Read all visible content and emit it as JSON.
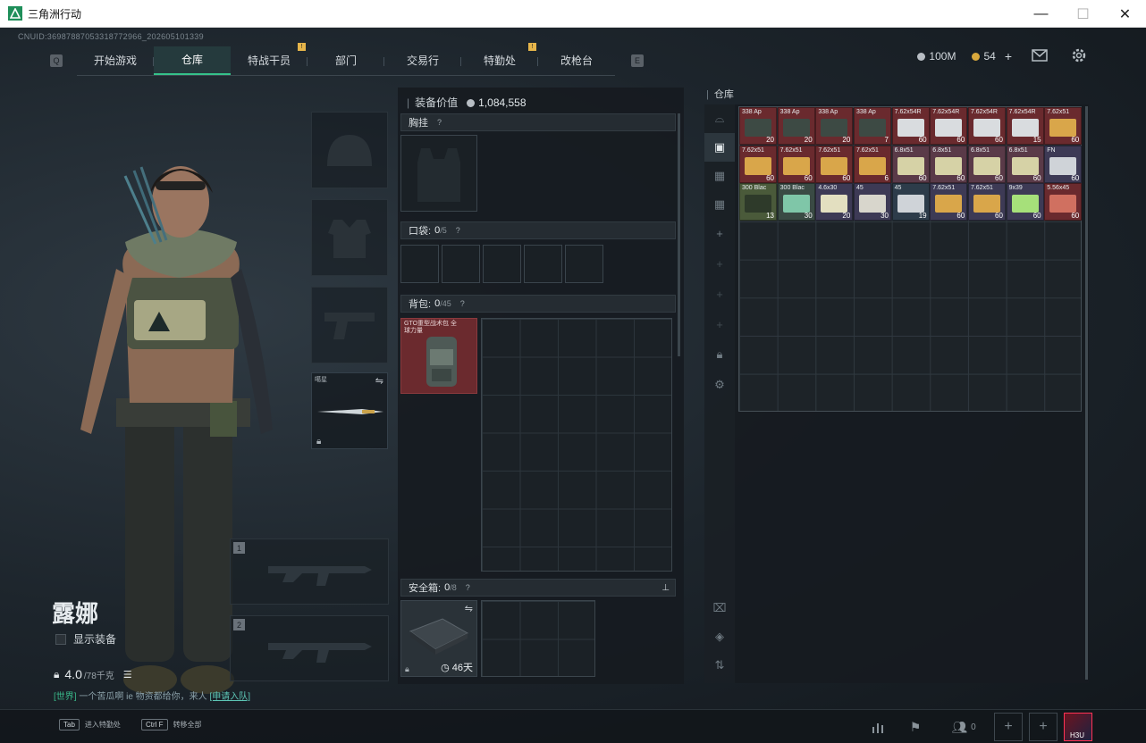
{
  "window": {
    "title": "三角洲行动",
    "controls": [
      "—",
      "☐",
      "✕"
    ]
  },
  "uid": "CNUID:369878870533187729​66_202605101339",
  "nav": {
    "left_key": "Q",
    "right_key": "E",
    "items": [
      {
        "label": "开始游戏",
        "active": false,
        "badge": false
      },
      {
        "label": "仓库",
        "active": true,
        "badge": false
      },
      {
        "label": "特战干员",
        "active": false,
        "badge": true
      },
      {
        "label": "部门",
        "active": false,
        "badge": false
      },
      {
        "label": "交易行",
        "active": false,
        "badge": false
      },
      {
        "label": "特勤处",
        "active": false,
        "badge": true
      },
      {
        "label": "改枪台",
        "active": false,
        "badge": false
      }
    ],
    "badge_text": "!"
  },
  "currency": {
    "silver": "100M",
    "gold": "54",
    "add": "+"
  },
  "character": {
    "name": "露娜",
    "show_equip_label": "显示装备",
    "weight": "4.0",
    "weight_cap": "/78千克",
    "melee_label": "噶星",
    "weapon_slot_1": "1",
    "weapon_slot_2": "2"
  },
  "chat": {
    "channel": "[世界]",
    "text": "一个苦瓜啊 ie  物资都给你，来人",
    "link": "[申请入队]"
  },
  "equipment": {
    "value_label": "装备价值",
    "value": "1,084,558",
    "chest_rig": {
      "label": "胸挂",
      "q": "?"
    },
    "pockets": {
      "label": "口袋:",
      "count": "0",
      "cap": "/5",
      "q": "?"
    },
    "backpack": {
      "label": "背包:",
      "count": "0",
      "cap": "/45",
      "q": "?",
      "item_name": "GTO重型战术包 全球力量"
    },
    "safe_box": {
      "label": "安全箱:",
      "count": "0",
      "cap": "/8",
      "q": "?",
      "time": "46天"
    }
  },
  "stash": {
    "label": "仓库",
    "items": [
      {
        "name": "338 Ap",
        "qty": "20",
        "color": "#6a2a2e",
        "box": "#3d4a44"
      },
      {
        "name": "338 Ap",
        "qty": "20",
        "color": "#6a2a2e",
        "box": "#3d4a44"
      },
      {
        "name": "338 Ap",
        "qty": "20",
        "color": "#6a2a2e",
        "box": "#3d4a44"
      },
      {
        "name": "338 Ap",
        "qty": "7",
        "color": "#6a2a2e",
        "box": "#3d4a44"
      },
      {
        "name": "7.62x54R",
        "qty": "60",
        "color": "#6a2a2e",
        "box": "#d9dcdf"
      },
      {
        "name": "7.62x54R",
        "qty": "60",
        "color": "#6a2a2e",
        "box": "#d9dcdf"
      },
      {
        "name": "7.62x54R",
        "qty": "60",
        "color": "#6a2a2e",
        "box": "#d9dcdf"
      },
      {
        "name": "7.62x54R",
        "qty": "15",
        "color": "#6a2a2e",
        "box": "#d9dcdf"
      },
      {
        "name": "7.62x51",
        "qty": "60",
        "color": "#6a2a2e",
        "box": "#d9a64a"
      },
      {
        "name": "7.62x51",
        "qty": "60",
        "color": "#6a2a2e",
        "box": "#d9a64a"
      },
      {
        "name": "7.62x51",
        "qty": "60",
        "color": "#6a2a2e",
        "box": "#d9a64a"
      },
      {
        "name": "7.62x51",
        "qty": "60",
        "color": "#6a2a2e",
        "box": "#d9a64a"
      },
      {
        "name": "7.62x51",
        "qty": "6",
        "color": "#6a2a2e",
        "box": "#d9a64a"
      },
      {
        "name": "6.8x51",
        "qty": "60",
        "color": "#5a3a48",
        "box": "#d6d2a6"
      },
      {
        "name": "6.8x51",
        "qty": "60",
        "color": "#5a3a48",
        "box": "#d6d2a6"
      },
      {
        "name": "6.8x51",
        "qty": "60",
        "color": "#5a3a48",
        "box": "#d6d2a6"
      },
      {
        "name": "6.8x51",
        "qty": "60",
        "color": "#5a3a48",
        "box": "#d6d2a6"
      },
      {
        "name": "FN",
        "qty": "60",
        "color": "#3d3a55",
        "box": "#cfd3d8"
      },
      {
        "name": "300 Blac",
        "qty": "13",
        "color": "#4a5a3a",
        "box": "#2e3a2a"
      },
      {
        "name": "300 Blac",
        "qty": "30",
        "color": "#3a4a44",
        "box": "#7fc6a8"
      },
      {
        "name": "4.6x30",
        "qty": "20",
        "color": "#3d3a55",
        "box": "#e3dfc0"
      },
      {
        "name": "45",
        "qty": "30",
        "color": "#3d3a55",
        "box": "#d8d6cc"
      },
      {
        "name": "45",
        "qty": "19",
        "color": "#2d3c4a",
        "box": "#cfd3d8"
      },
      {
        "name": "7.62x51",
        "qty": "60",
        "color": "#3d3a55",
        "box": "#d9a64a"
      },
      {
        "name": "7.62x51",
        "qty": "60",
        "color": "#3d3a55",
        "box": "#d9a64a"
      },
      {
        "name": "9x39",
        "qty": "60",
        "color": "#3d3a55",
        "box": "#a6e07a"
      },
      {
        "name": "5.56x45",
        "qty": "60",
        "color": "#6a2a2e",
        "box": "#d07060"
      }
    ]
  },
  "bottom": {
    "hint1_key": "Tab",
    "hint1": "进入特勤处",
    "hint2_key": "Ctrl F",
    "hint2": "转移全部",
    "team_count": "0",
    "avatar_text": "H3U"
  }
}
